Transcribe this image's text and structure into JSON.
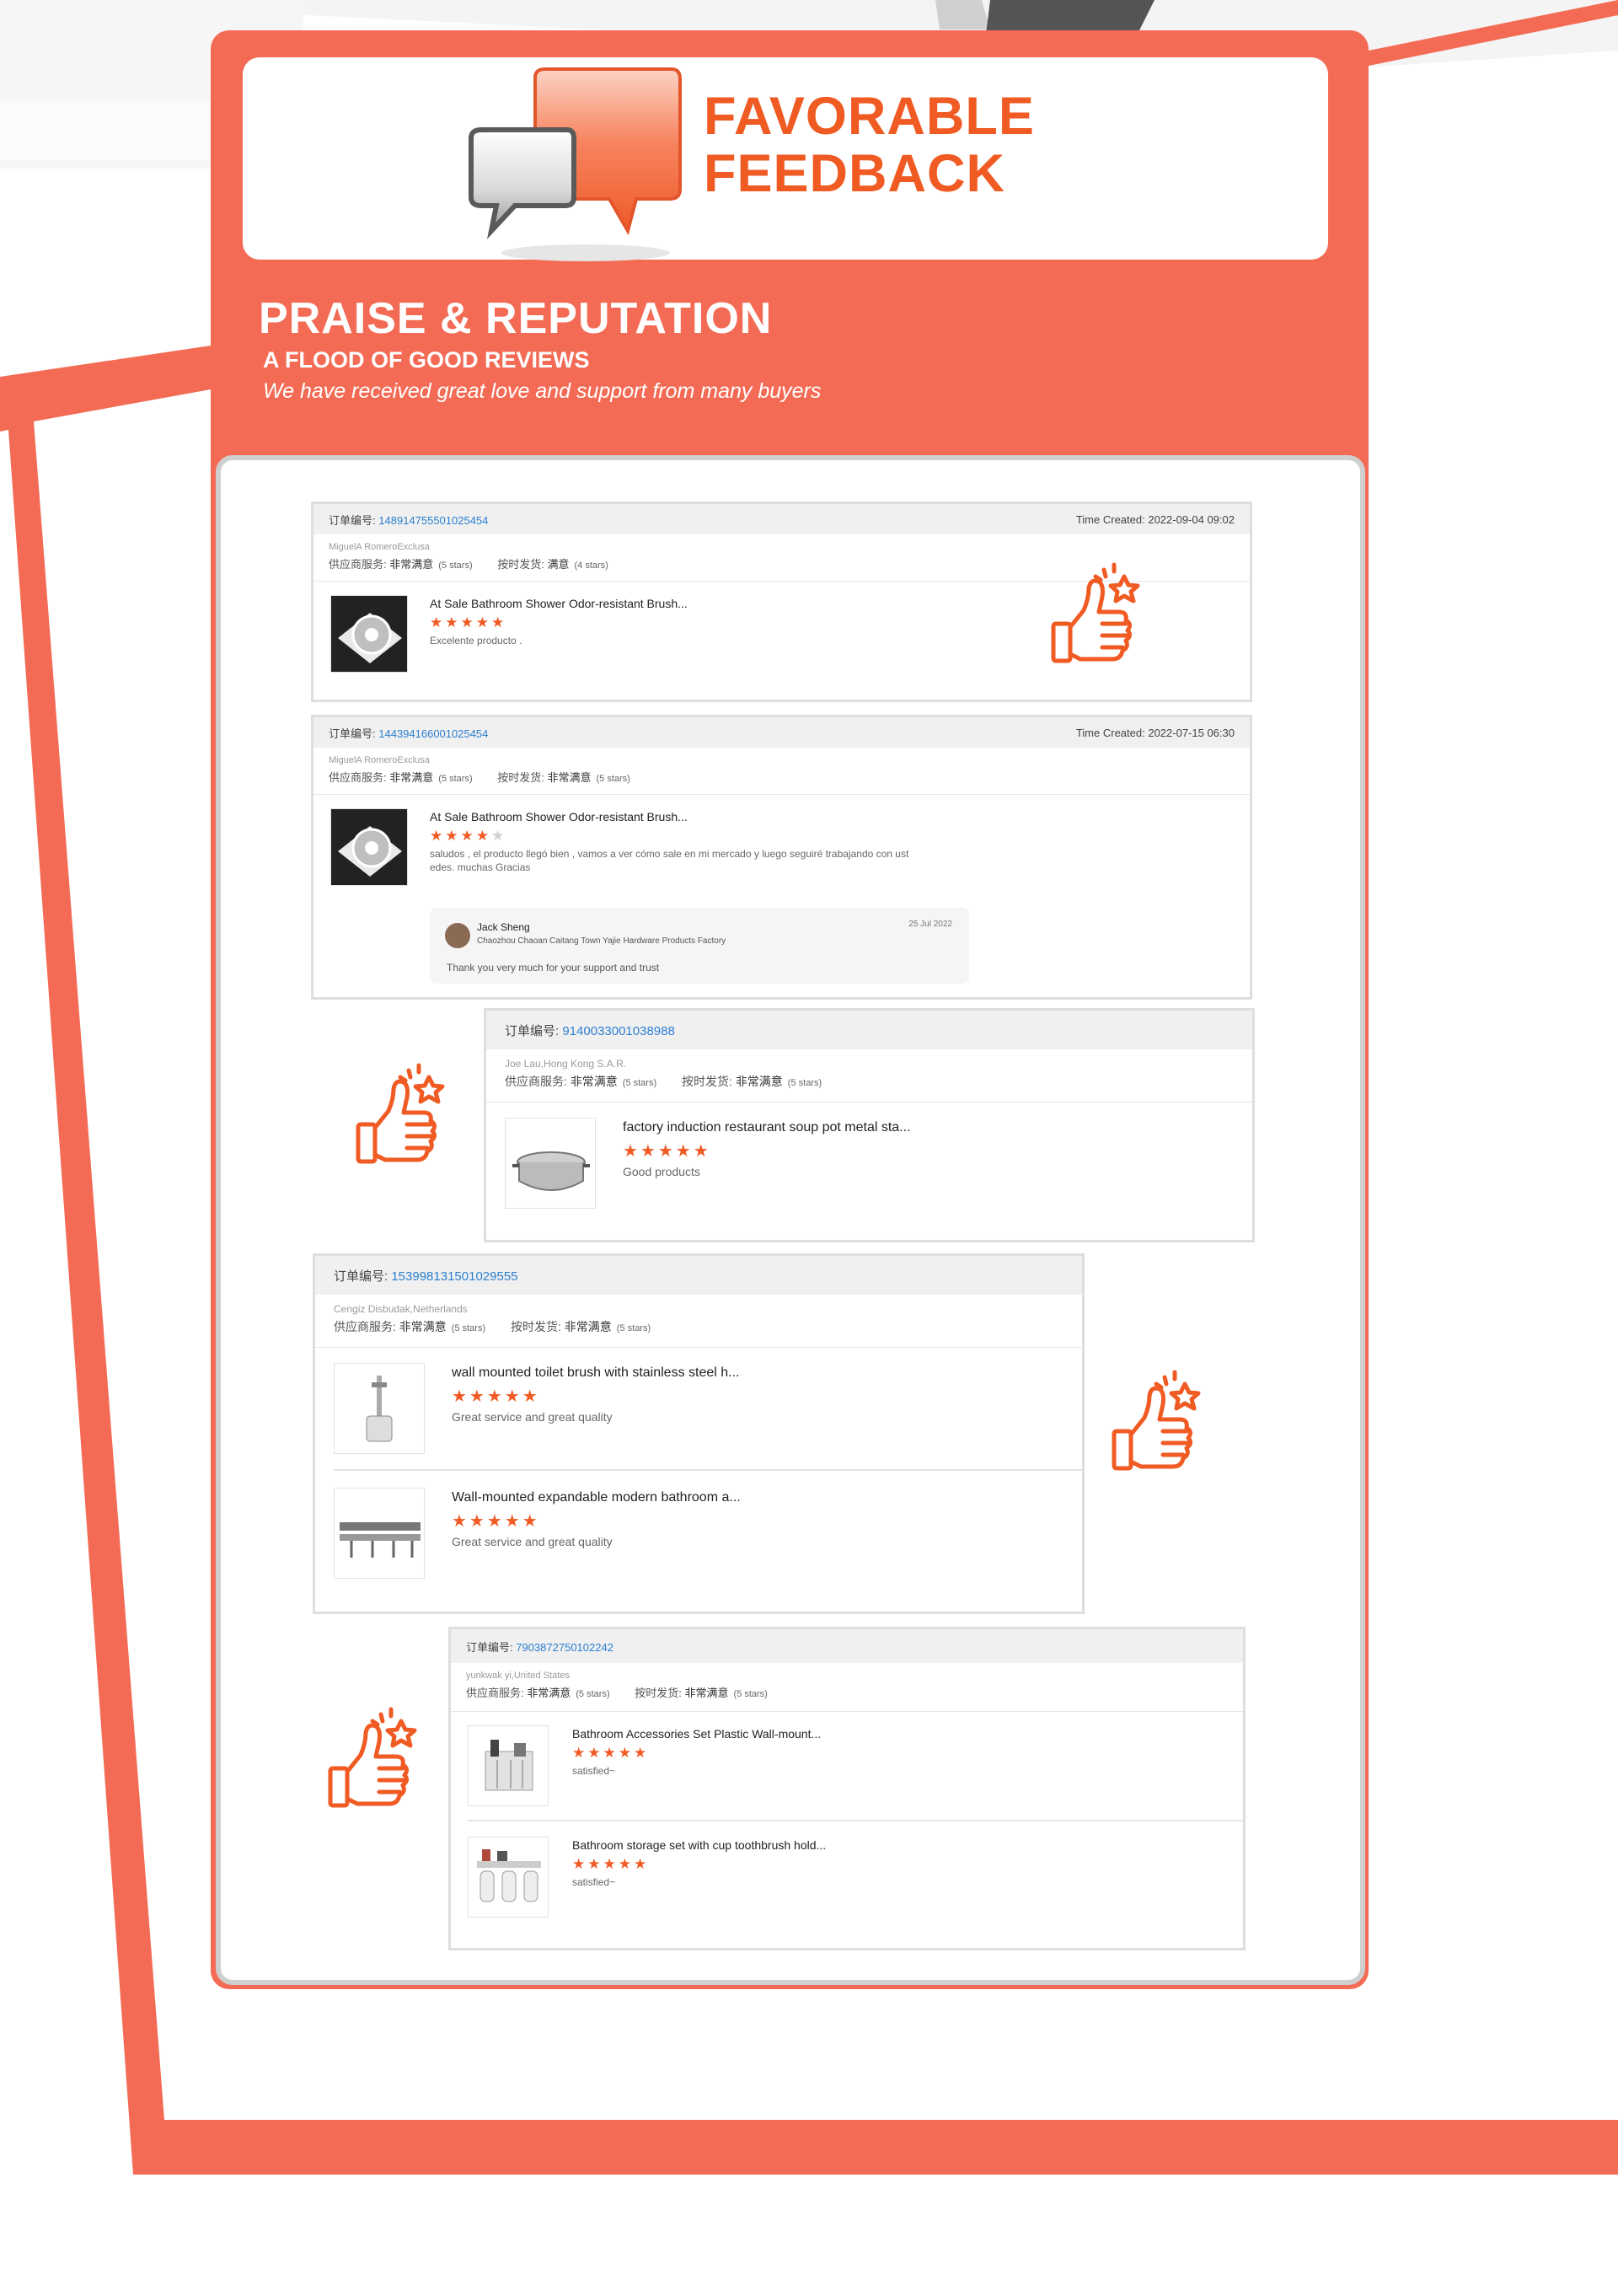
{
  "header": {
    "title_line1": "FAVORABLE",
    "title_line2": "FEEDBACK"
  },
  "praise": {
    "title": "PRAISE & REPUTATION",
    "subtitle": "A FLOOD OF GOOD REVIEWS",
    "tagline": "We have received great love and support from many buyers"
  },
  "labels": {
    "order_no": "订单编号:",
    "time_created": "Time Created:",
    "supplier_service": "供应商服务:",
    "on_time_shipping": "按时发货:",
    "very_satisfied": "非常满意",
    "satisfied": "满意",
    "five_stars": "(5 stars)",
    "four_stars": "(4 stars)"
  },
  "colors": {
    "accent": "#f36b55",
    "brand_orange": "#f05a23",
    "link_blue": "#2a7fd0",
    "star": "#f15a24"
  },
  "reviews": [
    {
      "order_no": "148914755501025454",
      "time": "2022-09-04 09:02",
      "buyer": "MiguelA RomeroExclusa",
      "supplier_note": "(5 stars)",
      "shipping_rating": "满意",
      "shipping_note": "(4 stars)",
      "items": [
        {
          "title": "At Sale Bathroom Shower Odor-resistant Brush...",
          "rating": 5,
          "comment": "Excelente producto ."
        }
      ]
    },
    {
      "order_no": "144394166001025454",
      "time": "2022-07-15 06:30",
      "buyer": "MiguelA RomeroExclusa",
      "supplier_note": "(5 stars)",
      "shipping_rating": "非常满意",
      "shipping_note": "(5 stars)",
      "items": [
        {
          "title": "At Sale Bathroom Shower Odor-resistant Brush...",
          "rating": 4,
          "comment_line1": "saludos , el producto llegó bien , vamos a ver cómo sale en mi mercado y luego seguiré trabajando con ust",
          "comment_line2": "edes. muchas Gracias"
        }
      ],
      "reply": {
        "name": "Jack Sheng",
        "company": "Chaozhou Chaoan Caitang Town Yajie Hardware Products Factory",
        "date": "25 Jul 2022",
        "text": "Thank you very much for your support and trust"
      }
    },
    {
      "order_no": "9140033001038988",
      "buyer": "Joe Lau,Hong Kong S.A.R.",
      "supplier_note": "(5 stars)",
      "shipping_rating": "非常满意",
      "shipping_note": "(5 stars)",
      "items": [
        {
          "title": "factory induction restaurant soup pot metal sta...",
          "rating": 5,
          "comment": "Good products"
        }
      ]
    },
    {
      "order_no": "153998131501029555",
      "buyer": "Cengiz Disbudak,Netherlands",
      "supplier_note": "(5 stars)",
      "shipping_rating": "非常满意",
      "shipping_note": "(5 stars)",
      "items": [
        {
          "title": "wall mounted toilet brush with stainless steel h...",
          "rating": 5,
          "comment": "Great service and great quality"
        },
        {
          "title": "Wall-mounted expandable modern bathroom a...",
          "rating": 5,
          "comment": "Great service and great quality"
        }
      ]
    },
    {
      "order_no": "7903872750102242",
      "buyer": "yunkwak yi,United States",
      "supplier_note": "(5 stars)",
      "shipping_rating": "非常满意",
      "shipping_note": "(5 stars)",
      "items": [
        {
          "title": "Bathroom Accessories Set Plastic Wall-mount...",
          "rating": 5,
          "comment": "satisfied~"
        },
        {
          "title": "Bathroom storage set with cup toothbrush hold...",
          "rating": 5,
          "comment": "satisfied~"
        }
      ]
    }
  ],
  "icons": [
    "speech-bubbles-icon",
    "thumbs-up-icon",
    "star-icon"
  ]
}
